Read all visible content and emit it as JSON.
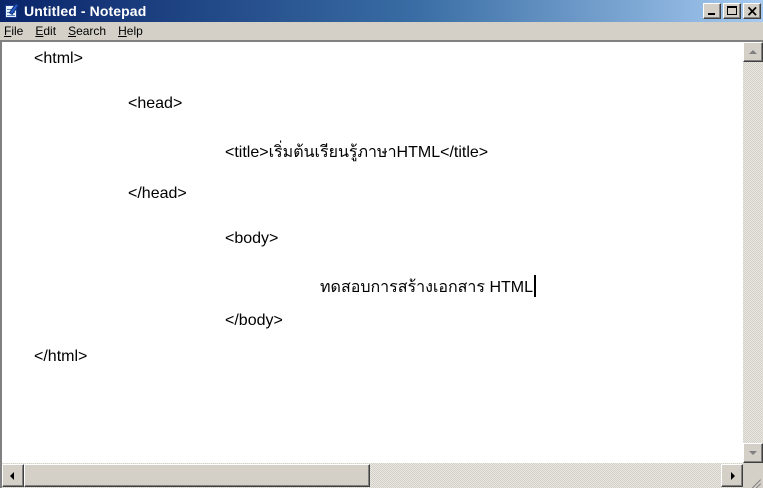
{
  "window": {
    "title": "Untitled - Notepad"
  },
  "menu": {
    "file": {
      "label": "File",
      "mnemonic": "F",
      "rest": "ile"
    },
    "edit": {
      "label": "Edit",
      "mnemonic": "E",
      "rest": "dit"
    },
    "search": {
      "label": "Search",
      "mnemonic": "S",
      "rest": "earch"
    },
    "help": {
      "label": "Help",
      "mnemonic": "H",
      "rest": "elp"
    }
  },
  "editor": {
    "lines": [
      "<html>",
      "<head>",
      "<title>เริ่มต้นเรียนรู้ภาษาHTML</title>",
      "</head>",
      "<body>",
      "ทดสอบการสร้างเอกสาร HTML",
      "</body>",
      "</html>"
    ]
  },
  "colors": {
    "titlebar_start": "#0a246a",
    "titlebar_end": "#a6caf0",
    "chrome": "#d4d0c8",
    "editor_bg": "#ffffff"
  },
  "icons": {
    "app": "notepad-icon",
    "minimize": "minimize-icon",
    "maximize": "maximize-icon",
    "close": "close-icon"
  }
}
